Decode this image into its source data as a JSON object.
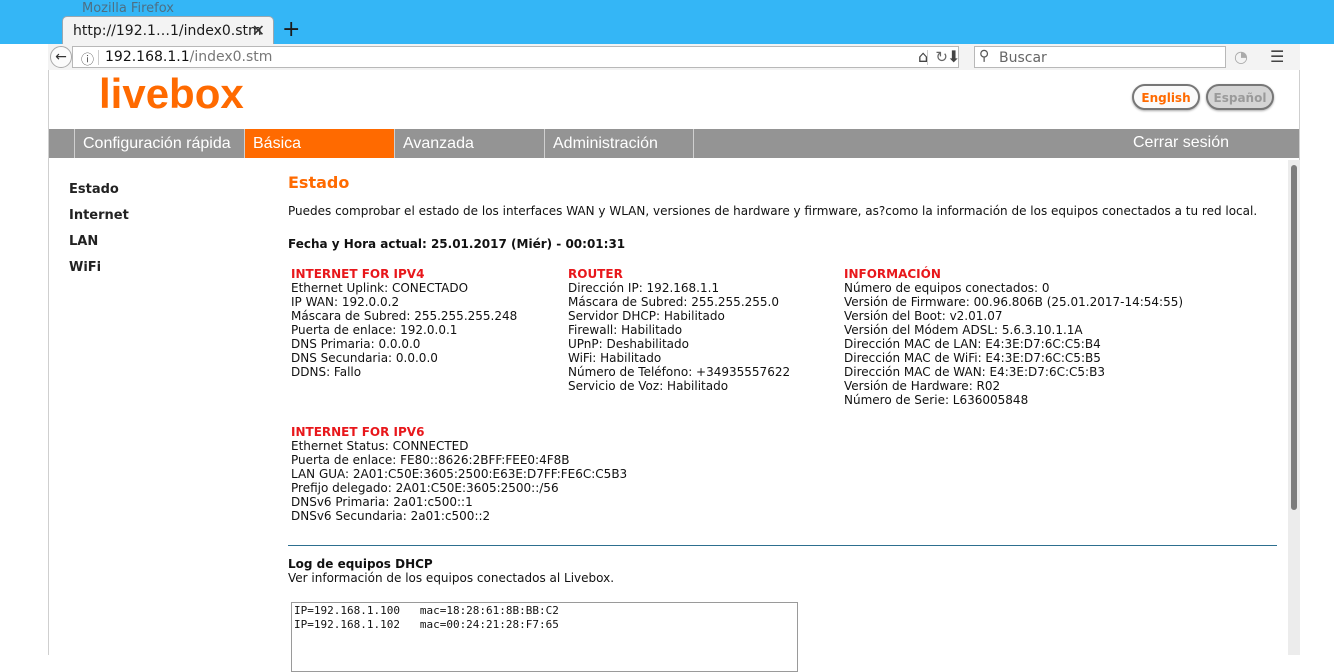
{
  "browser": {
    "window_title": "Mozilla Firefox",
    "tab_title": "http://192.1…1/index0.stm",
    "url_host": "192.168.1.1",
    "url_path": "/index0.stm",
    "search_placeholder": "Buscar"
  },
  "header": {
    "logo": "livebox",
    "lang_english": "English",
    "lang_spanish": "Español"
  },
  "menu": {
    "items": [
      "Configuración rápida",
      "Básica",
      "Avanzada",
      "Administración"
    ],
    "active": "Básica",
    "logout": "Cerrar sesión"
  },
  "sidebar": {
    "items": [
      "Estado",
      "Internet",
      "LAN",
      "WiFi"
    ]
  },
  "main": {
    "title": "Estado",
    "intro": "Puedes comprobar el estado de los interfaces WAN y WLAN, versiones de hardware y firmware, as?como la información de los equipos conectados a tu red local.",
    "datetime": "Fecha y Hora actual: 25.01.2017 (Miér) - 00:01:31",
    "ipv4": {
      "title": "INTERNET FOR IPV4",
      "lines": [
        "Ethernet Uplink:  CONECTADO",
        "IP WAN:  192.0.0.2",
        "Máscara de Subred:  255.255.255.248",
        "Puerta de enlace:  192.0.0.1",
        "DNS Primaria:  0.0.0.0",
        "DNS Secundaria:  0.0.0.0",
        "DDNS:  Fallo"
      ]
    },
    "router": {
      "title": "ROUTER",
      "lines": [
        "Dirección IP:  192.168.1.1",
        "Máscara de Subred:  255.255.255.0",
        "Servidor DHCP:  Habilitado",
        "Firewall:  Habilitado",
        "UPnP:  Deshabilitado",
        "WiFi:  Habilitado",
        "Número de Teléfono:  +34935557622",
        "Servicio de Voz:  Habilitado"
      ]
    },
    "info": {
      "title": "INFORMACIÓN",
      "lines": [
        "Número de equipos conectados:  0",
        "Versión de Firmware:  00.96.806B (25.01.2017-14:54:55)",
        "Versión del Boot:  v2.01.07",
        "Versión del Módem ADSL: 5.6.3.10.1.1A",
        "Dirección MAC de LAN: E4:3E:D7:6C:C5:B4",
        "Dirección MAC de WiFi: E4:3E:D7:6C:C5:B5",
        "Dirección MAC de WAN: E4:3E:D7:6C:C5:B3",
        "Versión de Hardware:  R02",
        "Número de Serie:   L636005848"
      ]
    },
    "ipv6": {
      "title": "INTERNET FOR IPV6",
      "lines": [
        "Ethernet Status:  CONNECTED",
        "Puerta de enlace:  FE80::8626:2BFF:FEE0:4F8B",
        "LAN GUA: 2A01:C50E:3605:2500:E63E:D7FF:FE6C:C5B3",
        "Prefijo delegado:  2A01:C50E:3605:2500::/56",
        "DNSv6 Primaria:  2a01:c500::1",
        "DNSv6 Secundaria:  2a01:c500::2"
      ]
    },
    "dhcp_log": {
      "title": "Log de equipos DHCP",
      "subtitle": "Ver información de los equipos conectados al Livebox.",
      "entries": [
        "IP=192.168.1.100   mac=18:28:61:8B:BB:C2",
        "IP=192.168.1.102   mac=00:24:21:28:F7:65"
      ]
    }
  }
}
